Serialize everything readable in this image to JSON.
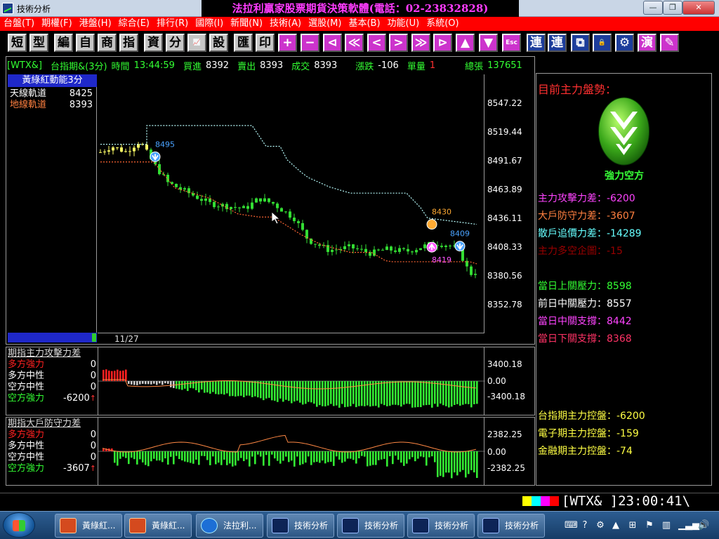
{
  "window": {
    "title": "技術分析",
    "banner": "法拉利贏家股票期貨決策軟體(電話：02-23832828)",
    "min_label": "—",
    "max_label": "❐",
    "close_label": "✕"
  },
  "menu": [
    "台盤(T)",
    "期權(F)",
    "港盤(H)",
    "綜合(E)",
    "排行(R)",
    "國際(I)",
    "新聞(N)",
    "技術(A)",
    "選股(M)",
    "基本(B)",
    "功能(U)",
    "系統(O)"
  ],
  "toolbar": {
    "buttons": [
      "短",
      "型",
      "編",
      "自",
      "商",
      "指",
      "資",
      "分",
      "📈",
      "設",
      "匯",
      "印",
      "+",
      "−",
      "⊲",
      "≪",
      "<",
      ">",
      "≫",
      "⊳",
      "▲",
      "▼",
      "Esc",
      "連",
      "連",
      "⧉",
      "🔒",
      "⚙",
      "演",
      "✎"
    ]
  },
  "info_bar": {
    "symbol": "[WTX&]",
    "name_period": "台指期&(3分)",
    "time_label": "時間",
    "time": "13:44:59",
    "bid_label": "買進",
    "bid": "8392",
    "ask_label": "賣出",
    "ask": "8393",
    "deal_label": "成交",
    "deal": "8393",
    "change_label": "漲跌",
    "change": "-106",
    "volume_label": "單量",
    "volume": "1",
    "total_label": "總張",
    "total": "137651"
  },
  "main_chart": {
    "indicator_title": "黃綠紅動能3分",
    "legend": [
      {
        "label": "天線軌道",
        "value": "8425",
        "color": "#ffffff"
      },
      {
        "label": "地線軌道",
        "value": "8393",
        "color": "#ff8040"
      }
    ],
    "y_ticks": [
      "8547.22",
      "8519.44",
      "8491.67",
      "8463.89",
      "8436.11",
      "8408.33",
      "8380.56",
      "8352.78"
    ],
    "date": "11/27",
    "markers": [
      {
        "label": "8495",
        "color": "#4aa3ff"
      },
      {
        "label": "8430",
        "color": "#ffaa33"
      },
      {
        "label": "8409",
        "color": "#4aa3ff"
      },
      {
        "label": "8419",
        "color": "#ff55ff"
      }
    ]
  },
  "sub1": {
    "title": "期指主力攻擊力差",
    "rows": [
      {
        "label": "多方強力",
        "value": "0",
        "color": "#ff2020"
      },
      {
        "label": "多方中性",
        "value": "0",
        "color": "#ffffff"
      },
      {
        "label": "空方中性",
        "value": "0",
        "color": "#ffffff"
      },
      {
        "label": "空方強力",
        "value": "-6200",
        "color": "#33ff33",
        "arrow": "↑"
      }
    ],
    "y_ticks": [
      "3400.18",
      "0.00",
      "-3400.18"
    ]
  },
  "sub2": {
    "title": "期指大戶防守力差",
    "rows": [
      {
        "label": "多方強力",
        "value": "0",
        "color": "#ff2020"
      },
      {
        "label": "多方中性",
        "value": "0",
        "color": "#ffffff"
      },
      {
        "label": "空方中性",
        "value": "0",
        "color": "#ffffff"
      },
      {
        "label": "空方強力",
        "value": "-3607",
        "color": "#33ff33",
        "arrow": "↑"
      }
    ],
    "y_ticks": [
      "2382.25",
      "0.00",
      "-2382.25"
    ]
  },
  "right_panel": {
    "trend_title": "目前主力盤勢：",
    "trend_label": "強力空方",
    "forces": [
      {
        "label": "主力攻擊力差：",
        "value": "-6200",
        "color": "#ff44ff"
      },
      {
        "label": "大戶防守力差：",
        "value": "-3607",
        "color": "#ff8040"
      },
      {
        "label": "散戶追價力差：",
        "value": "-14289",
        "color": "#66ffff"
      },
      {
        "label": "主力多空企圖：",
        "value": "-15",
        "color": "#990000"
      }
    ],
    "levels": [
      {
        "label": "當日上關壓力：",
        "value": "8598",
        "color": "#33ff33"
      },
      {
        "label": "前日中關壓力：",
        "value": "8557",
        "color": "#ffffff"
      },
      {
        "label": "當日中關支撐：",
        "value": "8442",
        "color": "#ff44ff"
      },
      {
        "label": "當日下關支撐：",
        "value": "8368",
        "color": "#ff3366"
      }
    ],
    "control": [
      {
        "label": "台指期主力控盤：",
        "value": "-6200",
        "color": "#ffff44"
      },
      {
        "label": "電子期主力控盤：",
        "value": "-159",
        "color": "#ffff44"
      },
      {
        "label": "金融期主力控盤：",
        "value": "-74",
        "color": "#ffff44"
      }
    ]
  },
  "status": {
    "colors": [
      "#ffff00",
      "#00ffff",
      "#ff00ff",
      "#ff0000"
    ],
    "text": "[WTX& ]23:00:41\\"
  },
  "taskbar": {
    "tasks": [
      {
        "label": "黃綠紅...",
        "icon": "document-icon"
      },
      {
        "label": "黃綠紅...",
        "icon": "document-icon"
      },
      {
        "label": "法拉利...",
        "icon": "app-icon"
      },
      {
        "label": "技術分析",
        "icon": "chart-icon"
      },
      {
        "label": "技術分析",
        "icon": "chart-icon"
      },
      {
        "label": "技術分析",
        "icon": "chart-icon"
      },
      {
        "label": "技術分析",
        "icon": "chart-icon"
      }
    ]
  }
}
